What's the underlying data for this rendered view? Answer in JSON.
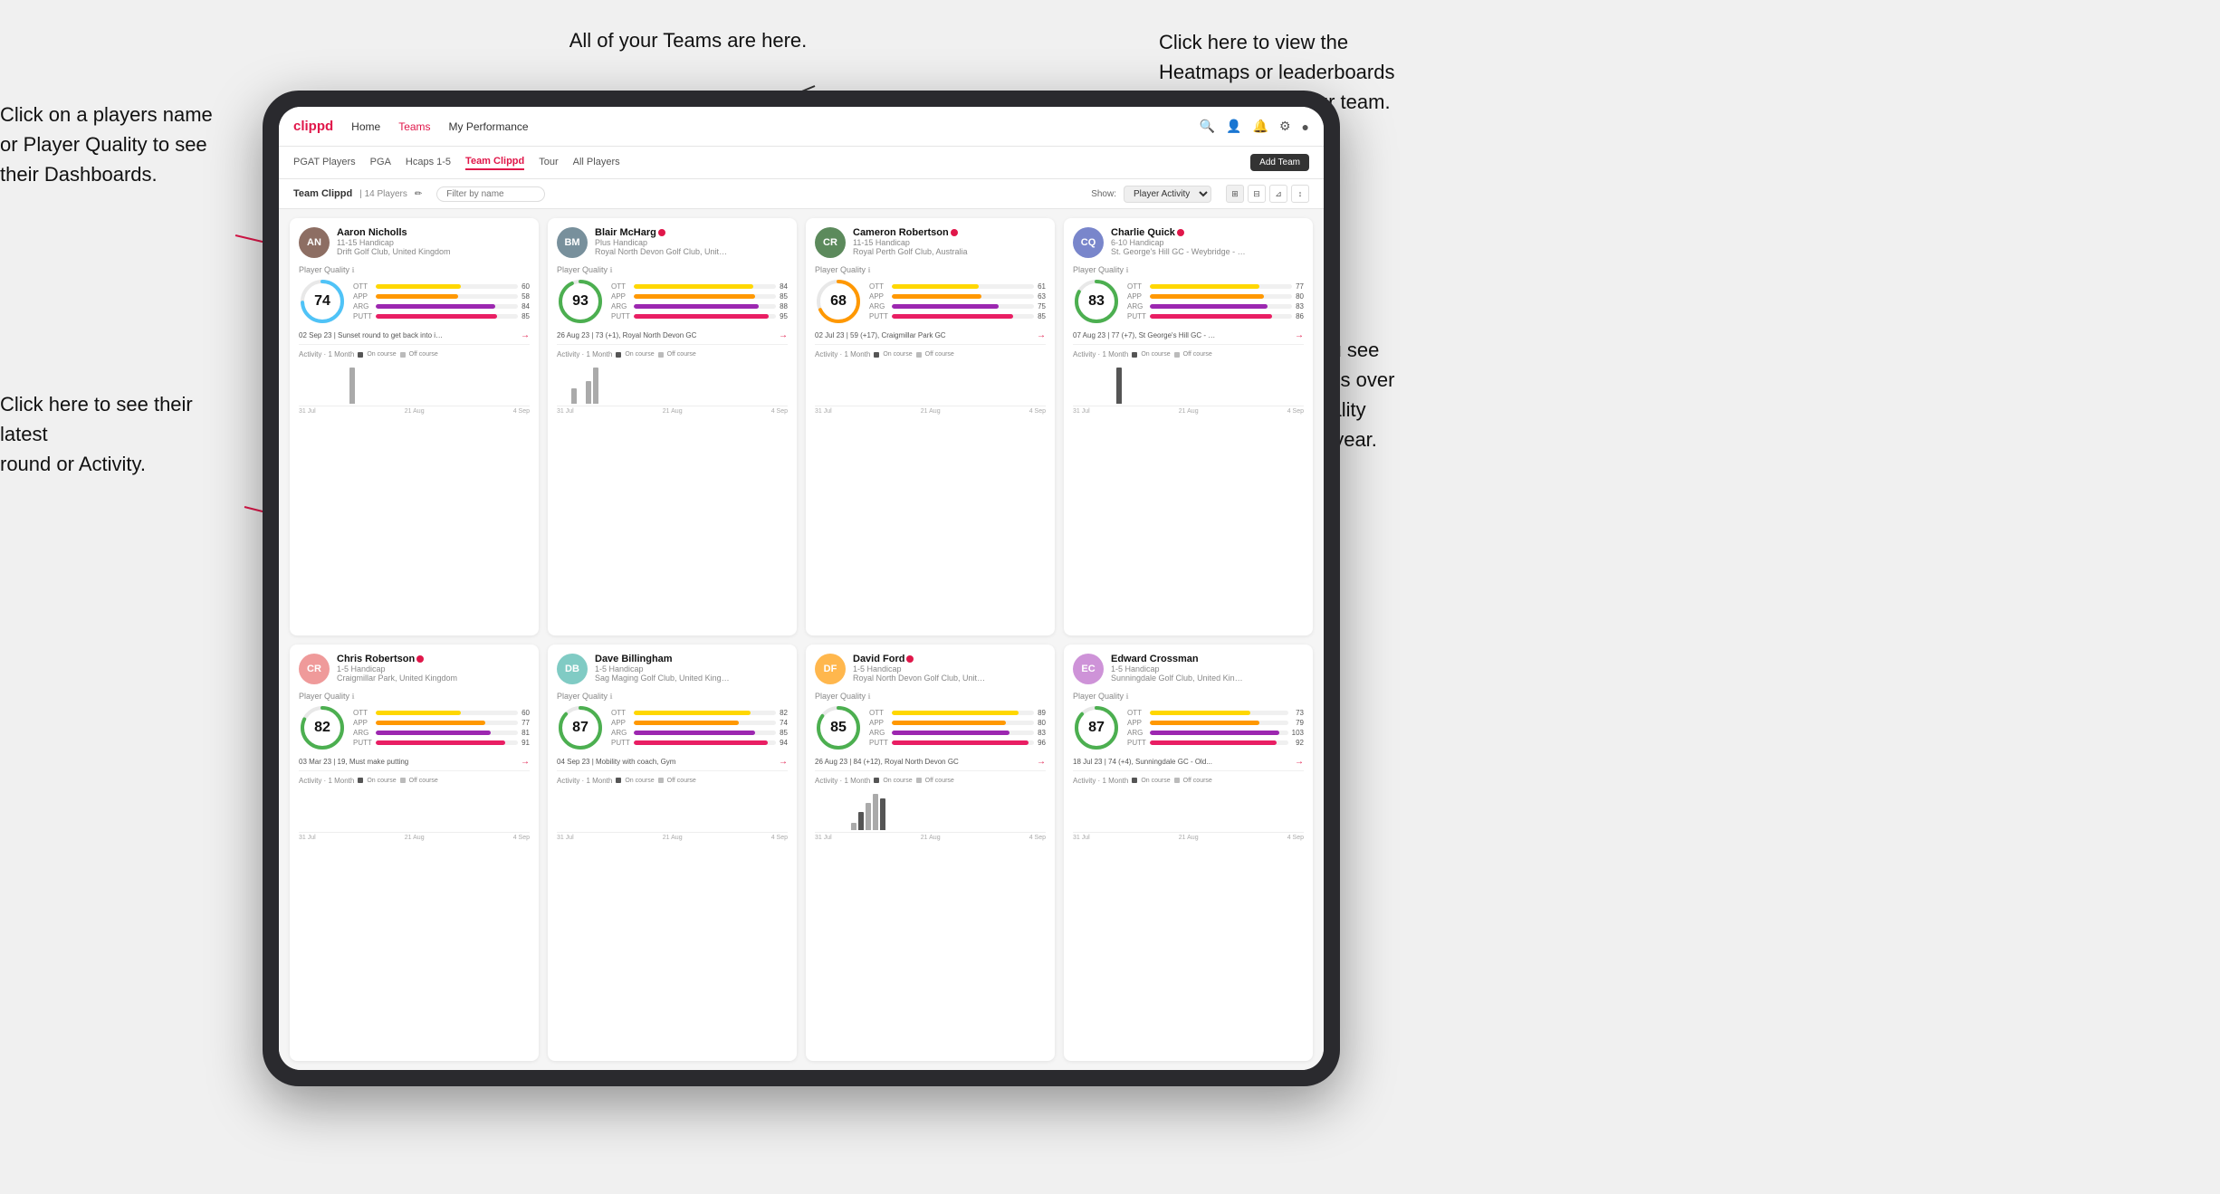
{
  "annotations": {
    "click_player": "Click on a players name\nor Player Quality to see\ntheir Dashboards.",
    "click_round": "Click here to see their latest\nround or Activity.",
    "teams_here": "All of your Teams are here.",
    "heatmaps": "Click here to view the\nHeatmaps or leaderboards\nand streaks for your team.",
    "activities": "Choose whether you see\nyour players Activities over\na month or their Quality\nScore Trend over a year."
  },
  "nav": {
    "logo": "clippd",
    "items": [
      "Home",
      "Teams",
      "My Performance"
    ],
    "active": "Teams"
  },
  "sub_nav": {
    "items": [
      "PGAT Players",
      "PGA",
      "Hcaps 1-5",
      "Team Clippd",
      "Tour",
      "All Players"
    ],
    "active": "Team Clippd",
    "add_team": "Add Team"
  },
  "team_header": {
    "name": "Team Clippd",
    "separator": "|",
    "count": "14 Players",
    "filter_placeholder": "Filter by name",
    "show_label": "Show:",
    "show_value": "Player Activity"
  },
  "players": [
    {
      "name": "Aaron Nicholls",
      "handicap": "11-15 Handicap",
      "club": "Drift Golf Club, United Kingdom",
      "quality": 74,
      "quality_color": "#4fc3f7",
      "stats": [
        {
          "label": "OTT",
          "color": "#ffd700",
          "value": 60,
          "max": 100
        },
        {
          "label": "APP",
          "color": "#ff9800",
          "value": 58,
          "max": 100
        },
        {
          "label": "ARG",
          "color": "#9c27b0",
          "value": 84,
          "max": 100
        },
        {
          "label": "PUTT",
          "color": "#e91e63",
          "value": 85,
          "max": 100
        }
      ],
      "latest_round": "02 Sep 23 | Sunset round to get back into it, F...",
      "activity_bars": [
        0,
        0,
        0,
        0,
        0,
        0,
        0,
        18,
        0,
        0,
        0,
        0
      ],
      "chart_dates": [
        "31 Jul",
        "21 Aug",
        "4 Sep"
      ]
    },
    {
      "name": "Blair McHarg",
      "handicap": "Plus Handicap",
      "club": "Royal North Devon Golf Club, United Kin...",
      "quality": 93,
      "quality_color": "#4caf50",
      "verified": true,
      "stats": [
        {
          "label": "OTT",
          "color": "#ffd700",
          "value": 84,
          "max": 100
        },
        {
          "label": "APP",
          "color": "#ff9800",
          "value": 85,
          "max": 100
        },
        {
          "label": "ARG",
          "color": "#9c27b0",
          "value": 88,
          "max": 100
        },
        {
          "label": "PUTT",
          "color": "#e91e63",
          "value": 95,
          "max": 100
        }
      ],
      "latest_round": "26 Aug 23 | 73 (+1), Royal North Devon GC",
      "activity_bars": [
        0,
        0,
        15,
        0,
        22,
        35,
        0,
        0,
        0,
        0,
        0,
        0
      ],
      "chart_dates": [
        "31 Jul",
        "21 Aug",
        "4 Sep"
      ]
    },
    {
      "name": "Cameron Robertson",
      "handicap": "11-15 Handicap",
      "club": "Royal Perth Golf Club, Australia",
      "quality": 68,
      "quality_color": "#ff9800",
      "verified": true,
      "stats": [
        {
          "label": "OTT",
          "color": "#ffd700",
          "value": 61,
          "max": 100
        },
        {
          "label": "APP",
          "color": "#ff9800",
          "value": 63,
          "max": 100
        },
        {
          "label": "ARG",
          "color": "#9c27b0",
          "value": 75,
          "max": 100
        },
        {
          "label": "PUTT",
          "color": "#e91e63",
          "value": 85,
          "max": 100
        }
      ],
      "latest_round": "02 Jul 23 | 59 (+17), Craigmillar Park GC",
      "activity_bars": [
        0,
        0,
        0,
        0,
        0,
        0,
        0,
        0,
        0,
        0,
        0,
        0
      ],
      "chart_dates": [
        "31 Jul",
        "21 Aug",
        "4 Sep"
      ]
    },
    {
      "name": "Charlie Quick",
      "handicap": "6-10 Handicap",
      "club": "St. George's Hill GC - Weybridge - Surre...",
      "quality": 83,
      "quality_color": "#4caf50",
      "verified": true,
      "stats": [
        {
          "label": "OTT",
          "color": "#ffd700",
          "value": 77,
          "max": 100
        },
        {
          "label": "APP",
          "color": "#ff9800",
          "value": 80,
          "max": 100
        },
        {
          "label": "ARG",
          "color": "#9c27b0",
          "value": 83,
          "max": 100
        },
        {
          "label": "PUTT",
          "color": "#e91e63",
          "value": 86,
          "max": 100
        }
      ],
      "latest_round": "07 Aug 23 | 77 (+7), St George's Hill GC - Red...",
      "activity_bars": [
        0,
        0,
        0,
        0,
        0,
        0,
        12,
        0,
        0,
        0,
        0,
        0
      ],
      "chart_dates": [
        "31 Jul",
        "21 Aug",
        "4 Sep"
      ]
    },
    {
      "name": "Chris Robertson",
      "handicap": "1-5 Handicap",
      "club": "Craigmillar Park, United Kingdom",
      "quality": 82,
      "quality_color": "#4caf50",
      "verified": true,
      "stats": [
        {
          "label": "OTT",
          "color": "#ffd700",
          "value": 60,
          "max": 100
        },
        {
          "label": "APP",
          "color": "#ff9800",
          "value": 77,
          "max": 100
        },
        {
          "label": "ARG",
          "color": "#9c27b0",
          "value": 81,
          "max": 100
        },
        {
          "label": "PUTT",
          "color": "#e91e63",
          "value": 91,
          "max": 100
        }
      ],
      "latest_round": "03 Mar 23 | 19, Must make putting",
      "activity_bars": [
        0,
        0,
        0,
        0,
        0,
        0,
        0,
        0,
        0,
        0,
        0,
        0
      ],
      "chart_dates": [
        "31 Jul",
        "21 Aug",
        "4 Sep"
      ]
    },
    {
      "name": "Dave Billingham",
      "handicap": "1-5 Handicap",
      "club": "Sag Maging Golf Club, United Kingdom",
      "quality": 87,
      "quality_color": "#4caf50",
      "stats": [
        {
          "label": "OTT",
          "color": "#ffd700",
          "value": 82,
          "max": 100
        },
        {
          "label": "APP",
          "color": "#ff9800",
          "value": 74,
          "max": 100
        },
        {
          "label": "ARG",
          "color": "#9c27b0",
          "value": 85,
          "max": 100
        },
        {
          "label": "PUTT",
          "color": "#e91e63",
          "value": 94,
          "max": 100
        }
      ],
      "latest_round": "04 Sep 23 | Mobility with coach, Gym",
      "activity_bars": [
        0,
        0,
        0,
        0,
        0,
        0,
        0,
        0,
        0,
        0,
        0,
        0
      ],
      "chart_dates": [
        "31 Jul",
        "21 Aug",
        "4 Sep"
      ]
    },
    {
      "name": "David Ford",
      "handicap": "1-5 Handicap",
      "club": "Royal North Devon Golf Club, United Kd...",
      "quality": 85,
      "quality_color": "#4caf50",
      "verified": true,
      "stats": [
        {
          "label": "OTT",
          "color": "#ffd700",
          "value": 89,
          "max": 100
        },
        {
          "label": "APP",
          "color": "#ff9800",
          "value": 80,
          "max": 100
        },
        {
          "label": "ARG",
          "color": "#9c27b0",
          "value": 83,
          "max": 100
        },
        {
          "label": "PUTT",
          "color": "#e91e63",
          "value": 96,
          "max": 100
        }
      ],
      "latest_round": "26 Aug 23 | 84 (+12), Royal North Devon GC",
      "activity_bars": [
        0,
        0,
        0,
        0,
        0,
        8,
        20,
        30,
        40,
        35,
        0,
        0
      ],
      "chart_dates": [
        "31 Jul",
        "21 Aug",
        "4 Sep"
      ]
    },
    {
      "name": "Edward Crossman",
      "handicap": "1-5 Handicap",
      "club": "Sunningdale Golf Club, United Kingdom",
      "quality": 87,
      "quality_color": "#4caf50",
      "stats": [
        {
          "label": "OTT",
          "color": "#ffd700",
          "value": 73,
          "max": 100
        },
        {
          "label": "APP",
          "color": "#ff9800",
          "value": 79,
          "max": 100
        },
        {
          "label": "ARG",
          "color": "#9c27b0",
          "value": 103,
          "max": 110
        },
        {
          "label": "PUTT",
          "color": "#e91e63",
          "value": 92,
          "max": 100
        }
      ],
      "latest_round": "18 Jul 23 | 74 (+4), Sunningdale GC - Old...",
      "activity_bars": [
        0,
        0,
        0,
        0,
        0,
        0,
        0,
        0,
        0,
        0,
        0,
        0
      ],
      "chart_dates": [
        "31 Jul",
        "21 Aug",
        "4 Sep"
      ]
    }
  ],
  "chart": {
    "on_course_color": "#555",
    "off_course_color": "#aaa",
    "month_label": "1 Month",
    "on_label": "On course",
    "off_label": "Off course"
  }
}
